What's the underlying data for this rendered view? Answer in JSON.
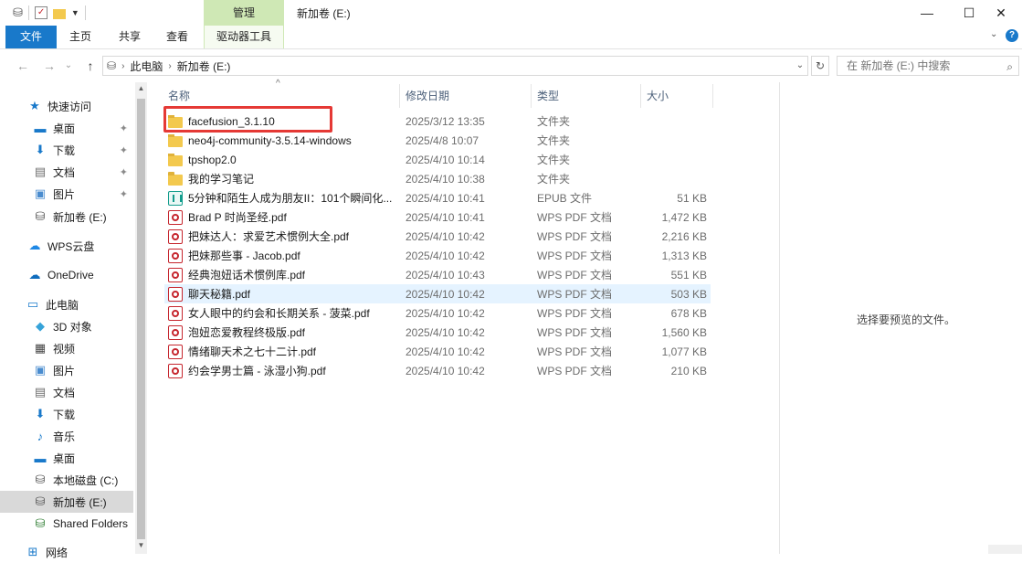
{
  "window": {
    "title": "新加卷 (E:)",
    "context_tab": "管理",
    "minimize": "—",
    "maximize": "☐",
    "close": "✕"
  },
  "ribbon": {
    "tabs": [
      "文件",
      "主页",
      "共享",
      "查看",
      "驱动器工具"
    ],
    "help": "?",
    "collapse": "⌄"
  },
  "address": {
    "back": "←",
    "forward": "→",
    "recent": "⌄",
    "up": "↑",
    "path": [
      "此电脑",
      "新加卷 (E:)"
    ],
    "search_placeholder": "在 新加卷 (E:) 中搜索"
  },
  "nav": {
    "items": [
      {
        "label": "快速访问",
        "icon": "star-icon",
        "pinned": false
      },
      {
        "label": "桌面",
        "icon": "desktop-icon",
        "pinned": true
      },
      {
        "label": "下载",
        "icon": "download-icon",
        "pinned": true
      },
      {
        "label": "文档",
        "icon": "document-icon",
        "pinned": true
      },
      {
        "label": "图片",
        "icon": "picture-icon",
        "pinned": true
      },
      {
        "label": "新加卷 (E:)",
        "icon": "drive-icon",
        "pinned": false
      },
      {
        "label": "WPS云盘",
        "icon": "cloud-icon",
        "pinned": false
      },
      {
        "label": "OneDrive",
        "icon": "onedrive-icon",
        "pinned": false
      },
      {
        "label": "此电脑",
        "icon": "computer-icon",
        "pinned": false
      },
      {
        "label": "3D 对象",
        "icon": "cube-icon",
        "pinned": false
      },
      {
        "label": "视频",
        "icon": "video-icon",
        "pinned": false
      },
      {
        "label": "图片",
        "icon": "picture-icon",
        "pinned": false
      },
      {
        "label": "文档",
        "icon": "document-icon",
        "pinned": false
      },
      {
        "label": "下载",
        "icon": "download-icon",
        "pinned": false
      },
      {
        "label": "音乐",
        "icon": "music-icon",
        "pinned": false
      },
      {
        "label": "桌面",
        "icon": "desktop-icon",
        "pinned": false
      },
      {
        "label": "本地磁盘 (C:)",
        "icon": "drive-icon",
        "pinned": false
      },
      {
        "label": "新加卷 (E:)",
        "icon": "drive-icon",
        "pinned": false,
        "selected": true
      },
      {
        "label": "Shared Folders",
        "icon": "network-drive-icon",
        "pinned": false
      },
      {
        "label": "网络",
        "icon": "network-icon",
        "pinned": false
      }
    ]
  },
  "columns": {
    "name": "名称",
    "date": "修改日期",
    "type": "类型",
    "size": "大小"
  },
  "files": [
    {
      "name": "facefusion_3.1.10",
      "date": "2025/3/12 13:35",
      "type": "文件夹",
      "size": "",
      "icon": "folder-icon"
    },
    {
      "name": "neo4j-community-3.5.14-windows",
      "date": "2025/4/8 10:07",
      "type": "文件夹",
      "size": "",
      "icon": "folder-icon"
    },
    {
      "name": "tpshop2.0",
      "date": "2025/4/10 10:14",
      "type": "文件夹",
      "size": "",
      "icon": "folder-icon"
    },
    {
      "name": "我的学习笔记",
      "date": "2025/4/10 10:38",
      "type": "文件夹",
      "size": "",
      "icon": "folder-icon"
    },
    {
      "name": "5分钟和陌生人成为朋友II：101个瞬间化...",
      "date": "2025/4/10 10:41",
      "type": "EPUB 文件",
      "size": "51 KB",
      "icon": "epub-icon"
    },
    {
      "name": "Brad P 时尚圣经.pdf",
      "date": "2025/4/10 10:41",
      "type": "WPS PDF 文档",
      "size": "1,472 KB",
      "icon": "pdf-icon"
    },
    {
      "name": "把妹达人：求爱艺术惯例大全.pdf",
      "date": "2025/4/10 10:42",
      "type": "WPS PDF 文档",
      "size": "2,216 KB",
      "icon": "pdf-icon"
    },
    {
      "name": "把妹那些事 - Jacob.pdf",
      "date": "2025/4/10 10:42",
      "type": "WPS PDF 文档",
      "size": "1,313 KB",
      "icon": "pdf-icon"
    },
    {
      "name": "经典泡妞话术惯例库.pdf",
      "date": "2025/4/10 10:43",
      "type": "WPS PDF 文档",
      "size": "551 KB",
      "icon": "pdf-icon"
    },
    {
      "name": "聊天秘籍.pdf",
      "date": "2025/4/10 10:42",
      "type": "WPS PDF 文档",
      "size": "503 KB",
      "icon": "pdf-icon",
      "selected": true
    },
    {
      "name": "女人眼中的约会和长期关系 - 菠菜.pdf",
      "date": "2025/4/10 10:42",
      "type": "WPS PDF 文档",
      "size": "678 KB",
      "icon": "pdf-icon"
    },
    {
      "name": "泡妞恋爱教程终极版.pdf",
      "date": "2025/4/10 10:42",
      "type": "WPS PDF 文档",
      "size": "1,560 KB",
      "icon": "pdf-icon"
    },
    {
      "name": "情绪聊天术之七十二计.pdf",
      "date": "2025/4/10 10:42",
      "type": "WPS PDF 文档",
      "size": "1,077 KB",
      "icon": "pdf-icon"
    },
    {
      "name": "约会学男士篇 - 泳湿小狗.pdf",
      "date": "2025/4/10 10:42",
      "type": "WPS PDF 文档",
      "size": "210 KB",
      "icon": "pdf-icon"
    }
  ],
  "preview": {
    "message": "选择要预览的文件。"
  },
  "colors": {
    "accent": "#1979ca",
    "context_tab": "#cfe8b5",
    "highlight": "#e53935",
    "selection": "#e5f3ff"
  }
}
